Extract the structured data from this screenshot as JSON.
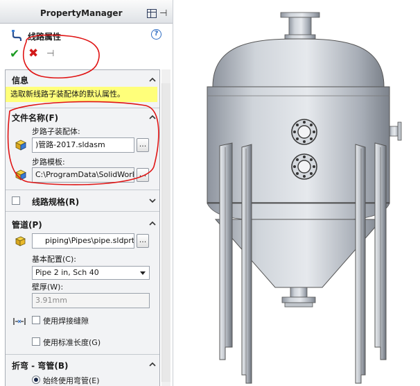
{
  "panel": {
    "header_title": "PropertyManager",
    "feature_title": "线路属性",
    "help_label": "?",
    "groups": {
      "info": {
        "title": "信息",
        "message": "选取新线路子装配体的默认属性。"
      },
      "file_name": {
        "title": "文件名称(F)",
        "subassembly_label": "步路子装配体:",
        "subassembly_value": ")管路-2017.sldasm",
        "template_label": "步路模板:",
        "template_value": "C:\\ProgramData\\SolidWorks",
        "browse_label": "..."
      },
      "route_spec": {
        "title": "线路规格(R)"
      },
      "pipe": {
        "title": "管道(P)",
        "pipe_value": "piping\\Pipes\\pipe.sldprt",
        "base_config_label": "基本配置(C):",
        "base_config_value": "Pipe 2 in, Sch 40",
        "wall_label": "壁厚(W):",
        "wall_value": "3.91mm",
        "use_weld_gap": "使用焊接缝隙",
        "use_standard_length": "使用标准长度(G)",
        "browse_label": "..."
      },
      "bends": {
        "title": "折弯 - 弯管(B)",
        "always_use_elbow": "始终使用弯管(E)"
      }
    }
  },
  "colors": {
    "accept": "#1c9b23",
    "cancel": "#d21a1a",
    "info_highlight": "#ffff7a",
    "ink_marker": "#e01414"
  }
}
